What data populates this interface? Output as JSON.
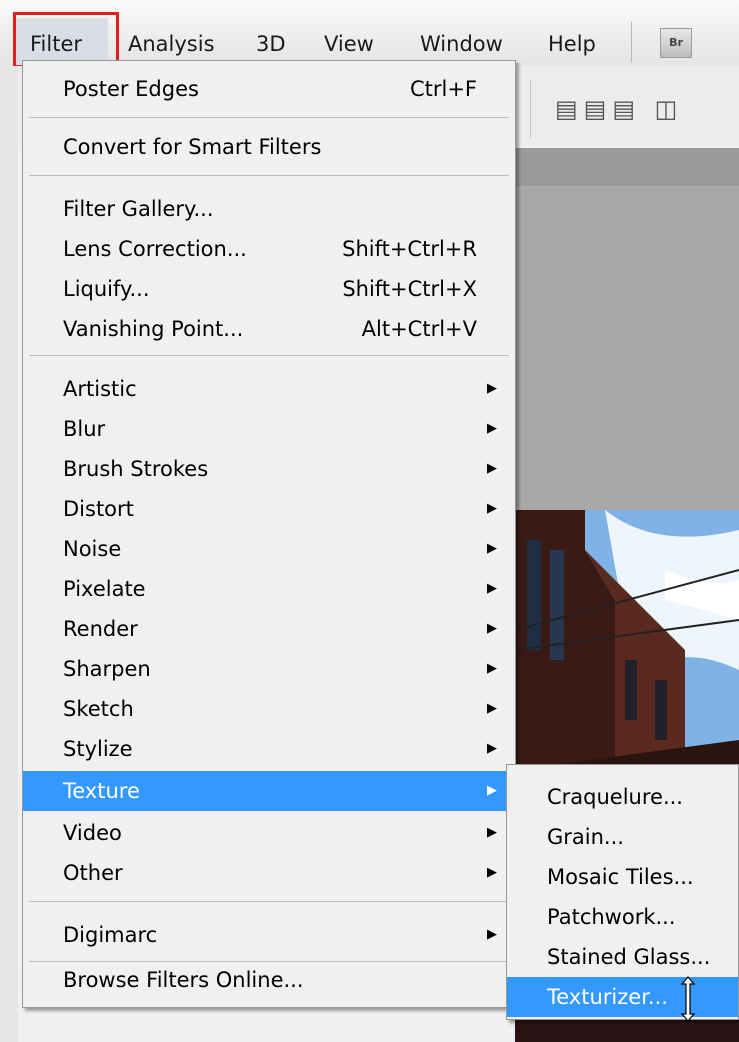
{
  "menubar": {
    "items": [
      "Filter",
      "Analysis",
      "3D",
      "View",
      "Window",
      "Help"
    ],
    "bridge_icon_label": "Br"
  },
  "filter_menu": {
    "last_filter": {
      "label": "Poster Edges",
      "shortcut": "Ctrl+F"
    },
    "smart": {
      "label": "Convert for Smart Filters"
    },
    "tools": [
      {
        "label": "Filter Gallery...",
        "shortcut": ""
      },
      {
        "label": "Lens Correction...",
        "shortcut": "Shift+Ctrl+R"
      },
      {
        "label": "Liquify...",
        "shortcut": "Shift+Ctrl+X"
      },
      {
        "label": "Vanishing Point...",
        "shortcut": "Alt+Ctrl+V"
      }
    ],
    "groups": [
      "Artistic",
      "Blur",
      "Brush Strokes",
      "Distort",
      "Noise",
      "Pixelate",
      "Render",
      "Sharpen",
      "Sketch",
      "Stylize",
      "Texture",
      "Video",
      "Other"
    ],
    "highlighted_group": "Texture",
    "digimarc": "Digimarc",
    "browse": "Browse Filters Online..."
  },
  "texture_submenu": {
    "items": [
      "Craquelure...",
      "Grain...",
      "Mosaic Tiles...",
      "Patchwork...",
      "Stained Glass...",
      "Texturizer..."
    ],
    "highlighted": "Texturizer..."
  },
  "colors": {
    "highlight": "#3399ff",
    "callout_border": "#e02020"
  }
}
